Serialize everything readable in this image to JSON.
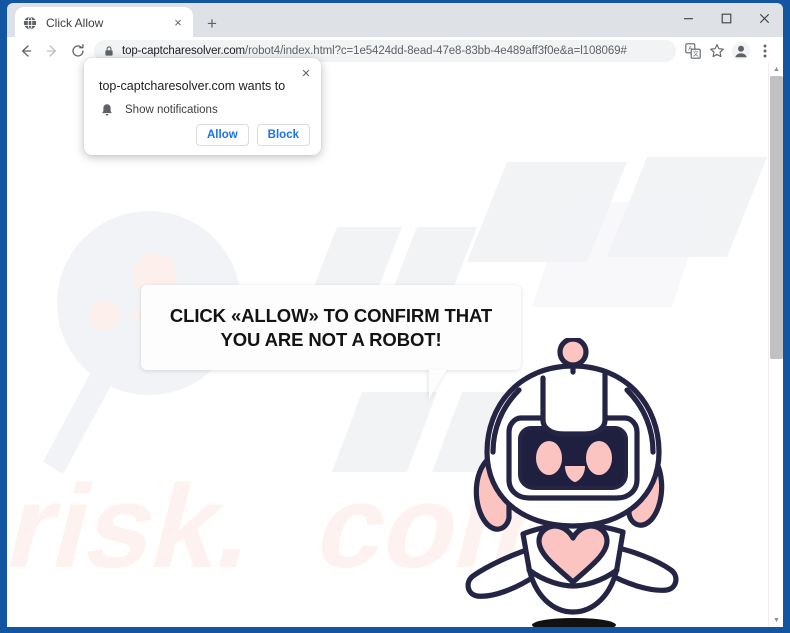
{
  "browser": {
    "tab": {
      "title": "Click Allow",
      "favicon": "globe-icon",
      "close_label": "×"
    },
    "newtab_label": "+",
    "window_controls": {
      "minimize": "─",
      "maximize": "□",
      "close": "✕"
    },
    "nav": {
      "back": "←",
      "forward": "→",
      "reload": "⟳"
    },
    "omnibox": {
      "lock_icon": "lock-icon",
      "host": "top-captcharesolver.com",
      "path": "/robot4/index.html?c=1e5424dd-8ead-47e8-83bb-4e489aff3f0e&a=l108069#",
      "full_url": "top-captcharesolver.com/robot4/index.html?c=1e5424dd-8ead-47e8-83bb-4e489aff3f0e&a=l108069#"
    },
    "toolbar_icons": [
      "translate-icon",
      "bookmark-star-icon",
      "profile-avatar-icon",
      "three-dot-menu-icon"
    ]
  },
  "permission_dialog": {
    "title": "top-captcharesolver.com wants to",
    "permission_icon": "bell-icon",
    "permission_label": "Show notifications",
    "allow_label": "Allow",
    "block_label": "Block",
    "close_label": "✕",
    "accent_color": "#1a73e8"
  },
  "page": {
    "bubble_text": "CLICK «ALLOW» TO CONFIRM THAT YOU ARE NOT A ROBOT!",
    "watermark_text": "pcrisk.com",
    "mascot": "robot-mascot",
    "colors": {
      "background": "#ffffff",
      "outline": "#242445",
      "accent_pink": "#fbc4c0",
      "visor": "#1f2040",
      "watermark_gray": "#f2f3f5",
      "watermark_pink": "#fdf2ef",
      "frame_blue": "#1255a0"
    }
  },
  "scrollbar": {
    "up_arrow": "▲",
    "down_arrow": "▼"
  }
}
